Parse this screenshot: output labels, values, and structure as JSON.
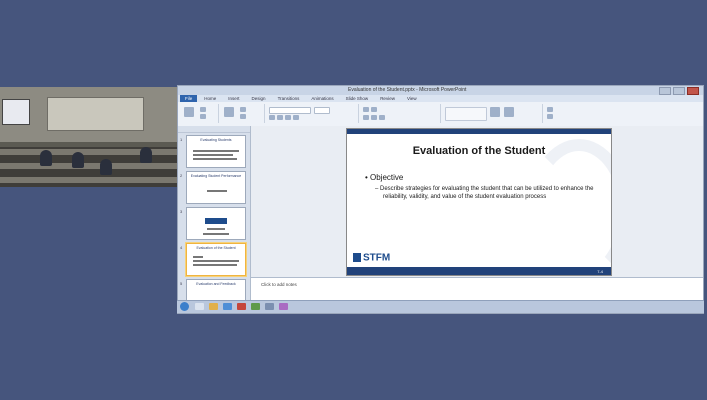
{
  "window": {
    "title": "Evaluation of the Student.pptx - Microsoft PowerPoint"
  },
  "ribbon_tabs": [
    "File",
    "Home",
    "Insert",
    "Design",
    "Transitions",
    "Animations",
    "Slide Show",
    "Review",
    "View"
  ],
  "thumbnails": [
    {
      "num": "1",
      "title": "Evaluating Students"
    },
    {
      "num": "2",
      "title": "Evaluating Student Performance"
    },
    {
      "num": "3",
      "title": "STFM"
    },
    {
      "num": "4",
      "title": "Evaluation of the Student",
      "selected": true
    },
    {
      "num": "5",
      "title": "Evaluation and Feedback"
    }
  ],
  "slide": {
    "title": "Evaluation of the Student",
    "bullet": "Objective",
    "sub_bullet": "– Describe strategies for evaluating the student that can be utilized to enhance the reliability, validity, and value of the student evaluation process",
    "logo_text": "STFM",
    "page_number": "7-4"
  },
  "notes": {
    "placeholder": "Click to add notes"
  },
  "colors": {
    "background": "#46557d",
    "slide_band": "#21427a",
    "logo_blue": "#1e4c8c"
  }
}
